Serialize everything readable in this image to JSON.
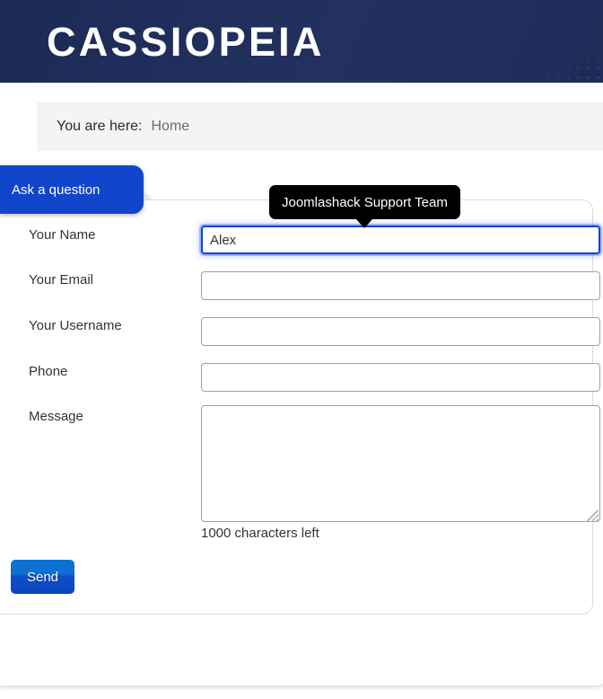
{
  "header": {
    "brand": "CASSIOPEIA"
  },
  "breadcrumb": {
    "label": "You are here:",
    "current": "Home"
  },
  "page": {
    "ghost_title": "Home"
  },
  "ask_tab": {
    "label": "Ask a question"
  },
  "tooltip": {
    "text": "Joomlashack Support Team"
  },
  "form": {
    "fields": [
      {
        "label": "Your Name",
        "value": "Alex",
        "placeholder": "",
        "focused": true
      },
      {
        "label": "Your Email",
        "value": "",
        "placeholder": "",
        "focused": false
      },
      {
        "label": "Your Username",
        "value": "",
        "placeholder": "",
        "focused": false
      },
      {
        "label": "Phone",
        "value": "",
        "placeholder": "",
        "focused": false
      }
    ],
    "message": {
      "label": "Message",
      "value": "",
      "placeholder": "",
      "char_count": "1000 characters left"
    },
    "submit_label": "Send"
  },
  "colors": {
    "header_navy": "#1d2c58",
    "tab_blue": "#1145cc",
    "button_blue": "#0c45c4",
    "focus_blue": "#1a3fd0",
    "breadcrumb_bg": "#f4f4f4",
    "tooltip_bg": "#000000"
  }
}
